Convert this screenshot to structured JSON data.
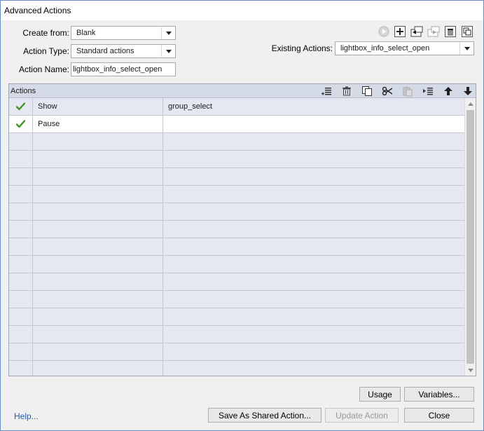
{
  "window": {
    "title": "Advanced Actions"
  },
  "form": {
    "create_from_label": "Create from:",
    "create_from_value": "Blank",
    "action_type_label": "Action Type:",
    "action_type_value": "Standard actions",
    "action_name_label": "Action Name:",
    "action_name_value": "lightbox_info_select_open",
    "existing_actions_label": "Existing Actions:",
    "existing_actions_value": "lightbox_info_select_open"
  },
  "top_toolbar": [
    {
      "name": "preview-play-icon",
      "enabled": false
    },
    {
      "name": "add-new-action-icon",
      "enabled": true
    },
    {
      "name": "import-action-icon",
      "enabled": true
    },
    {
      "name": "export-action-icon",
      "enabled": false
    },
    {
      "name": "delete-action-icon",
      "enabled": true
    },
    {
      "name": "duplicate-action-icon",
      "enabled": true
    }
  ],
  "actions_panel": {
    "title": "Actions",
    "toolbar": [
      {
        "name": "insert-action-icon",
        "enabled": true
      },
      {
        "name": "delete-icon",
        "enabled": true
      },
      {
        "name": "copy-icon",
        "enabled": true
      },
      {
        "name": "cut-icon",
        "enabled": true
      },
      {
        "name": "paste-icon",
        "enabled": false
      },
      {
        "name": "indent-icon",
        "enabled": true
      },
      {
        "name": "move-up-icon",
        "enabled": true
      },
      {
        "name": "move-down-icon",
        "enabled": true
      }
    ],
    "rows": [
      {
        "checked": true,
        "action": "Show",
        "target": "group_select"
      },
      {
        "checked": true,
        "action": "Pause",
        "target": ""
      },
      {
        "checked": false,
        "action": "",
        "target": ""
      },
      {
        "checked": false,
        "action": "",
        "target": ""
      },
      {
        "checked": false,
        "action": "",
        "target": ""
      },
      {
        "checked": false,
        "action": "",
        "target": ""
      },
      {
        "checked": false,
        "action": "",
        "target": ""
      },
      {
        "checked": false,
        "action": "",
        "target": ""
      },
      {
        "checked": false,
        "action": "",
        "target": ""
      },
      {
        "checked": false,
        "action": "",
        "target": ""
      },
      {
        "checked": false,
        "action": "",
        "target": ""
      },
      {
        "checked": false,
        "action": "",
        "target": ""
      },
      {
        "checked": false,
        "action": "",
        "target": ""
      },
      {
        "checked": false,
        "action": "",
        "target": ""
      },
      {
        "checked": false,
        "action": "",
        "target": ""
      },
      {
        "checked": false,
        "action": "",
        "target": ""
      }
    ]
  },
  "buttons": {
    "usage": "Usage",
    "variables": "Variables...",
    "save_shared": "Save As Shared Action...",
    "update_action": "Update Action",
    "close": "Close"
  },
  "help_link": "Help...",
  "colors": {
    "checkmark": "#3a9a1e",
    "link": "#1a5fb4",
    "panel_bg": "#e5e8f0",
    "selected_row": "#ffffff"
  }
}
